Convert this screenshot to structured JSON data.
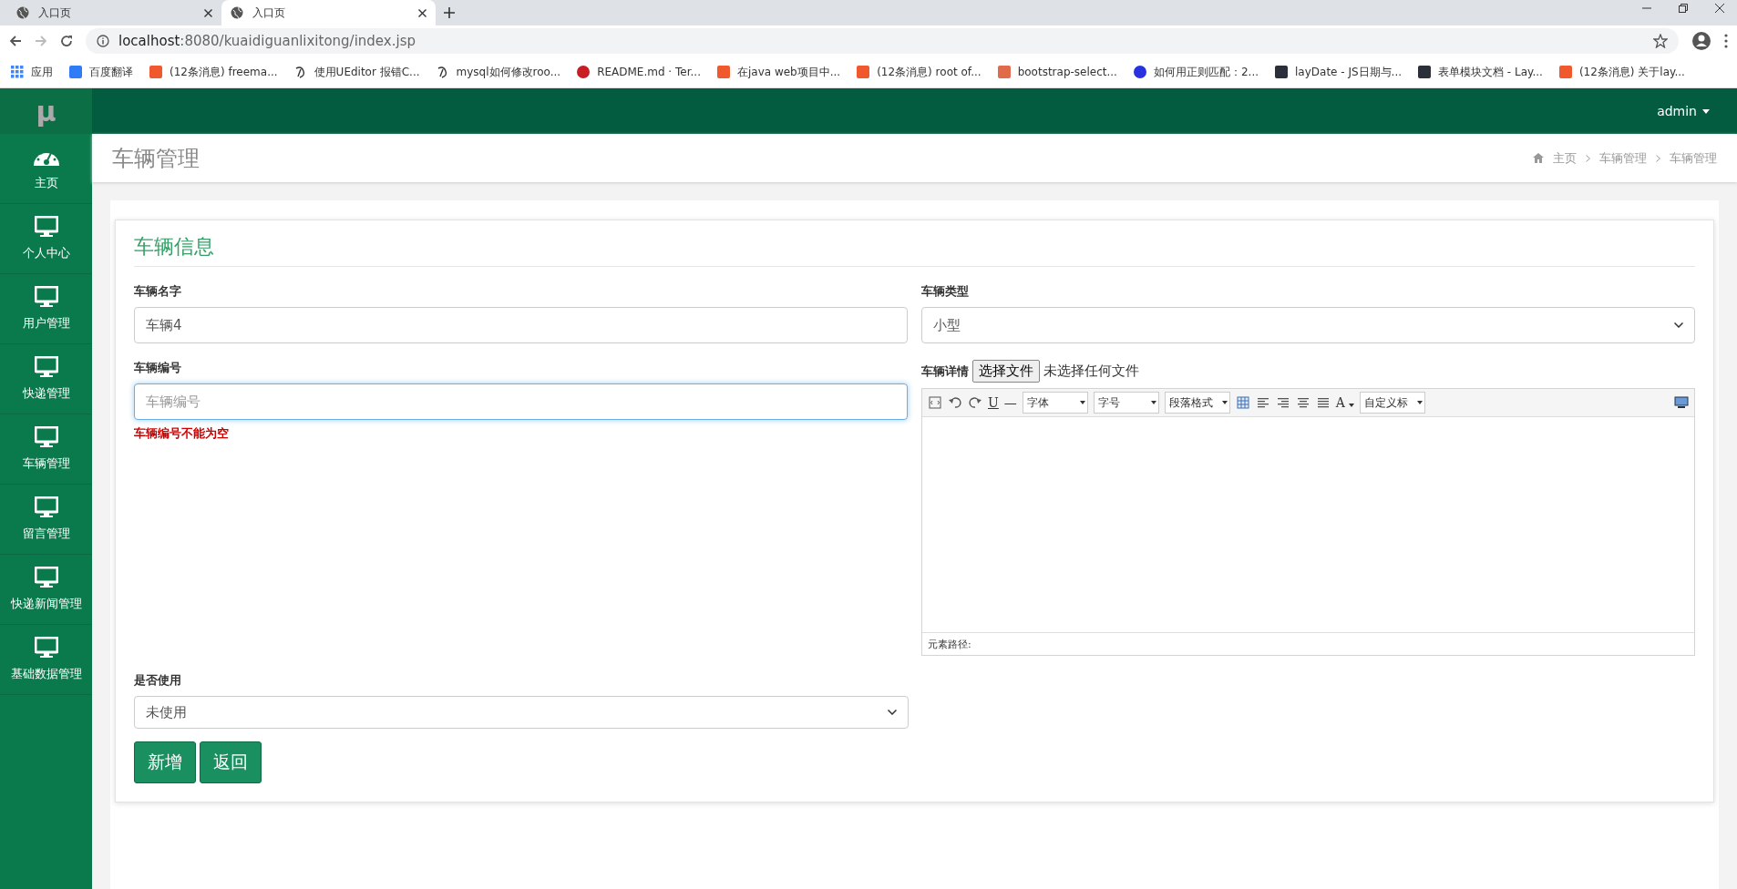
{
  "browser": {
    "tabs": [
      {
        "title": "入口页",
        "selected": false
      },
      {
        "title": "入口页",
        "selected": true
      }
    ],
    "url_host": "localhost",
    "url_rest": ":8080/kuaidiguanlixitong/index.jsp",
    "bookmarks": [
      {
        "label": "应用",
        "kind": "apps",
        "color": "#4285f4"
      },
      {
        "label": "百度翻译",
        "kind": "square",
        "color": "#2f7cf6"
      },
      {
        "label": "(12条消息) freema...",
        "kind": "square",
        "color": "#f0582e"
      },
      {
        "label": "使用UEditor 报错C...",
        "kind": "glyph",
        "color": "#333333"
      },
      {
        "label": "mysql如何修改roo...",
        "kind": "glyph",
        "color": "#333333"
      },
      {
        "label": "README.md · Ter...",
        "kind": "circle",
        "color": "#c71d23"
      },
      {
        "label": "在java web项目中...",
        "kind": "square",
        "color": "#f0582e"
      },
      {
        "label": "(12条消息) root of...",
        "kind": "square",
        "color": "#f0582e"
      },
      {
        "label": "bootstrap-select...",
        "kind": "square",
        "color": "#e06a4a"
      },
      {
        "label": "如何用正则匹配：2...",
        "kind": "circle",
        "color": "#2932e1"
      },
      {
        "label": "layDate - JS日期与...",
        "kind": "square",
        "color": "#2b2f3a"
      },
      {
        "label": "表单模块文档 - Lay...",
        "kind": "square",
        "color": "#2b2f3a"
      },
      {
        "label": "(12条消息) 关于lay...",
        "kind": "square",
        "color": "#f0582e"
      }
    ]
  },
  "app": {
    "logo": "μ",
    "user": "admin",
    "sidebar": [
      {
        "label": "主页",
        "kind": "dashboard"
      },
      {
        "label": "个人中心",
        "kind": "monitor"
      },
      {
        "label": "用户管理",
        "kind": "monitor"
      },
      {
        "label": "快递管理",
        "kind": "monitor"
      },
      {
        "label": "车辆管理",
        "kind": "monitor"
      },
      {
        "label": "留言管理",
        "kind": "monitor"
      },
      {
        "label": "快递新闻管理",
        "kind": "monitor"
      },
      {
        "label": "基础数据管理",
        "kind": "monitor"
      }
    ],
    "page_title": "车辆管理",
    "breadcrumb": [
      "主页",
      "车辆管理",
      "车辆管理"
    ]
  },
  "form": {
    "title": "车辆信息",
    "name_field": {
      "label": "车辆名字",
      "value": "车辆4"
    },
    "type_field": {
      "label": "车辆类型",
      "value": "小型"
    },
    "number_field": {
      "label": "车辆编号",
      "placeholder": "车辆编号",
      "error": "车辆编号不能为空"
    },
    "detail": {
      "label": "车辆详情",
      "file_button": "选择文件",
      "file_status": "未选择任何文件",
      "toolbar": [
        {
          "kind": "source"
        },
        {
          "kind": "undo"
        },
        {
          "kind": "redo"
        },
        {
          "kind": "text",
          "text": "U"
        },
        {
          "kind": "text",
          "text": "—"
        },
        {
          "kind": "dropdown",
          "text": "字体"
        },
        {
          "kind": "dropdown",
          "text": "字号"
        },
        {
          "kind": "dropdown",
          "text": "段落格式"
        },
        {
          "kind": "table"
        },
        {
          "kind": "align-left"
        },
        {
          "kind": "align-right"
        },
        {
          "kind": "align-center"
        },
        {
          "kind": "justify"
        },
        {
          "kind": "text-caret",
          "text": "A"
        },
        {
          "kind": "dropdown",
          "text": "自定义标"
        }
      ],
      "path_label": "元素路径:"
    },
    "usage_field": {
      "label": "是否使用",
      "value": "未使用"
    },
    "buttons": [
      "新增",
      "返回"
    ]
  }
}
